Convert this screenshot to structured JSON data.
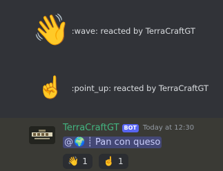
{
  "reactions_log": [
    {
      "emoji": "👋",
      "text": ":wave: reacted by TerraCraftGT"
    },
    {
      "emoji": "☝️",
      "text": ":point_up: reacted by TerraCraftGT"
    }
  ],
  "message": {
    "author": "TerraCraftGT",
    "badge": "BOT",
    "timestamp": "Today at 12:30",
    "mention_at": "@",
    "mention_icon": "🌍",
    "separator": "┊",
    "channel": "Pan con queso",
    "reactions": [
      {
        "emoji": "👋",
        "count": "1"
      },
      {
        "emoji": "☝️",
        "count": "1"
      }
    ]
  },
  "colors": {
    "background": "#313338",
    "message_highlight": "#3a3a35",
    "author": "#43b581",
    "bot_badge": "#5865f2",
    "mention_bg": "#5865f2"
  }
}
